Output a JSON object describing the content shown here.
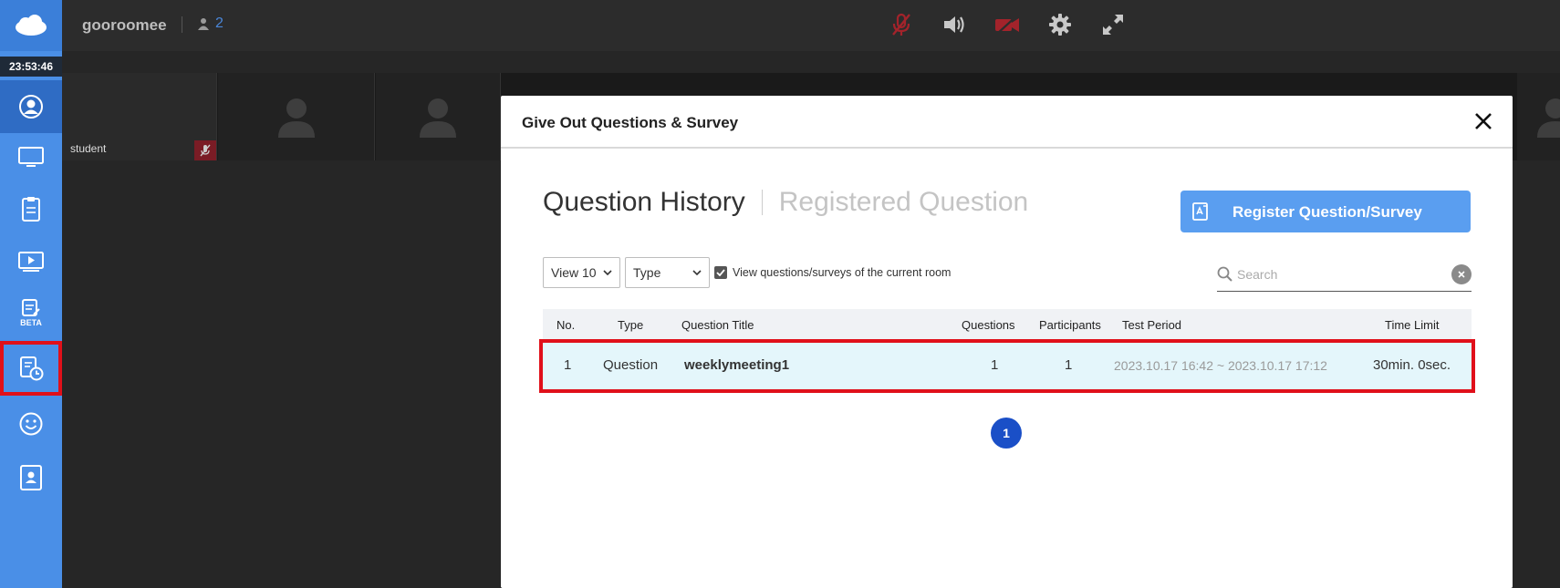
{
  "app": {
    "room_name": "gooroomee",
    "user_count": "2",
    "clock": "23:53:46"
  },
  "sidebar": {
    "items": [
      {
        "icon": "profile-icon"
      },
      {
        "icon": "screen-share-icon"
      },
      {
        "icon": "clipboard-icon"
      },
      {
        "icon": "video-play-icon"
      },
      {
        "icon": "beta-note-icon",
        "badge": "BETA"
      },
      {
        "icon": "quiz-timer-icon"
      },
      {
        "icon": "emoji-icon"
      },
      {
        "icon": "contact-card-icon"
      }
    ]
  },
  "topbar": {
    "icons": [
      "mic-off-icon",
      "speaker-icon",
      "camera-off-icon",
      "gear-icon",
      "fullscreen-icon"
    ]
  },
  "video": {
    "tile_name": "student"
  },
  "modal": {
    "title": "Give Out Questions & Survey",
    "tab_active": "Question History",
    "tab_inactive": "Registered Question",
    "register_button": "Register Question/Survey",
    "view_select": "View 10",
    "type_select": "Type",
    "checkbox_label": "View questions/surveys of the current room",
    "search_placeholder": "Search",
    "table": {
      "headers": {
        "no": "No.",
        "type": "Type",
        "title": "Question Title",
        "questions": "Questions",
        "participants": "Participants",
        "period": "Test Period",
        "time_limit": "Time Limit"
      },
      "rows": [
        {
          "no": "1",
          "type": "Question",
          "title": "weeklymeeting1",
          "questions": "1",
          "participants": "1",
          "period": "2023.10.17 16:42 ~ 2023.10.17 17:12",
          "time_limit": "30min. 0sec."
        }
      ]
    },
    "current_page": "1"
  },
  "colors": {
    "sidebar": "#4a8fe7",
    "accent_button": "#5a9ef0",
    "highlight_outline": "#e0101a",
    "page_active": "#1a4fc7"
  }
}
